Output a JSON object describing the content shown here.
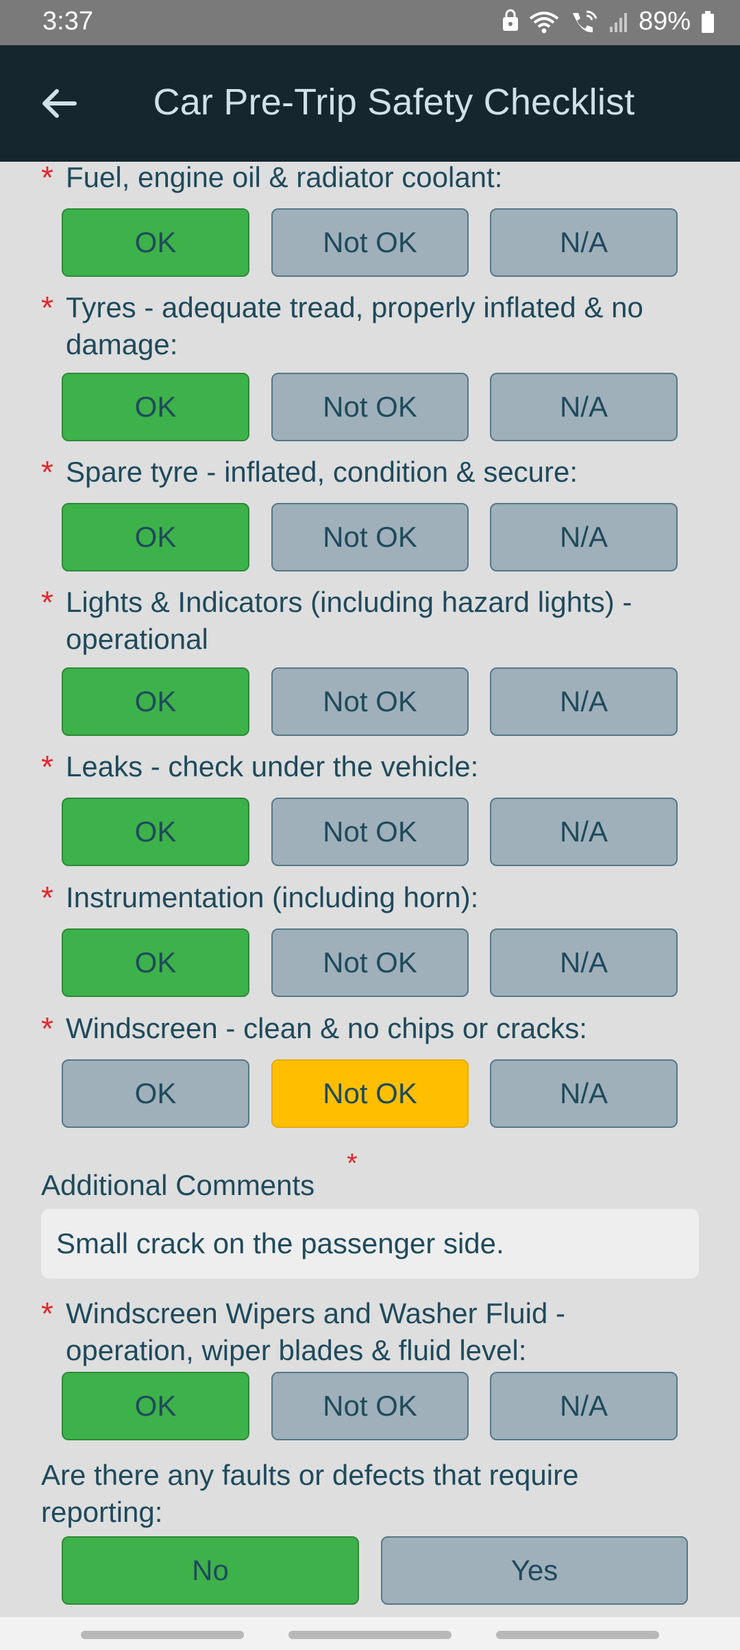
{
  "status_bar": {
    "time": "3:37",
    "battery": "89%",
    "icons": [
      "lock-icon",
      "wifi-icon",
      "wifi-call-icon",
      "signal-icon",
      "battery-icon"
    ]
  },
  "app_bar": {
    "title": "Car Pre-Trip Safety Checklist",
    "back_icon": "arrow-left-icon"
  },
  "required_mark": "*",
  "questions": [
    {
      "label": "Fuel, engine oil & radiator coolant:",
      "options": [
        "OK",
        "Not OK",
        "N/A"
      ],
      "selected": "OK"
    },
    {
      "label": "Tyres -  adequate tread, properly inflated & no damage:",
      "options": [
        "OK",
        "Not OK",
        "N/A"
      ],
      "selected": "OK"
    },
    {
      "label": "Spare tyre - inflated, condition & secure:",
      "options": [
        "OK",
        "Not OK",
        "N/A"
      ],
      "selected": "OK"
    },
    {
      "label": "Lights & Indicators (including hazard lights) - operational",
      "options": [
        "OK",
        "Not OK",
        "N/A"
      ],
      "selected": "OK"
    },
    {
      "label": "Leaks - check under the vehicle:",
      "options": [
        "OK",
        "Not OK",
        "N/A"
      ],
      "selected": "OK"
    },
    {
      "label": "Instrumentation (including horn):",
      "options": [
        "OK",
        "Not OK",
        "N/A"
      ],
      "selected": "OK"
    },
    {
      "label": "Windscreen - clean & no chips or cracks:",
      "options": [
        "OK",
        "Not OK",
        "N/A"
      ],
      "selected": "Not OK"
    },
    {
      "label": "Windscreen Wipers and Washer Fluid - operation, wiper blades & fluid level:",
      "options": [
        "OK",
        "Not OK",
        "N/A"
      ],
      "selected": "OK"
    }
  ],
  "comments": {
    "label": "Additional Comments",
    "value": "Small crack on the passenger side."
  },
  "faults": {
    "label": "Are there any faults or defects that require reporting:",
    "options": [
      "No",
      "Yes"
    ],
    "selected": "No"
  },
  "colors": {
    "ok_selected": "#3db14a",
    "notok_selected": "#ffbf00",
    "unselected": "#9fb0ba",
    "required": "#e3262b",
    "app_bar": "#15262e"
  }
}
